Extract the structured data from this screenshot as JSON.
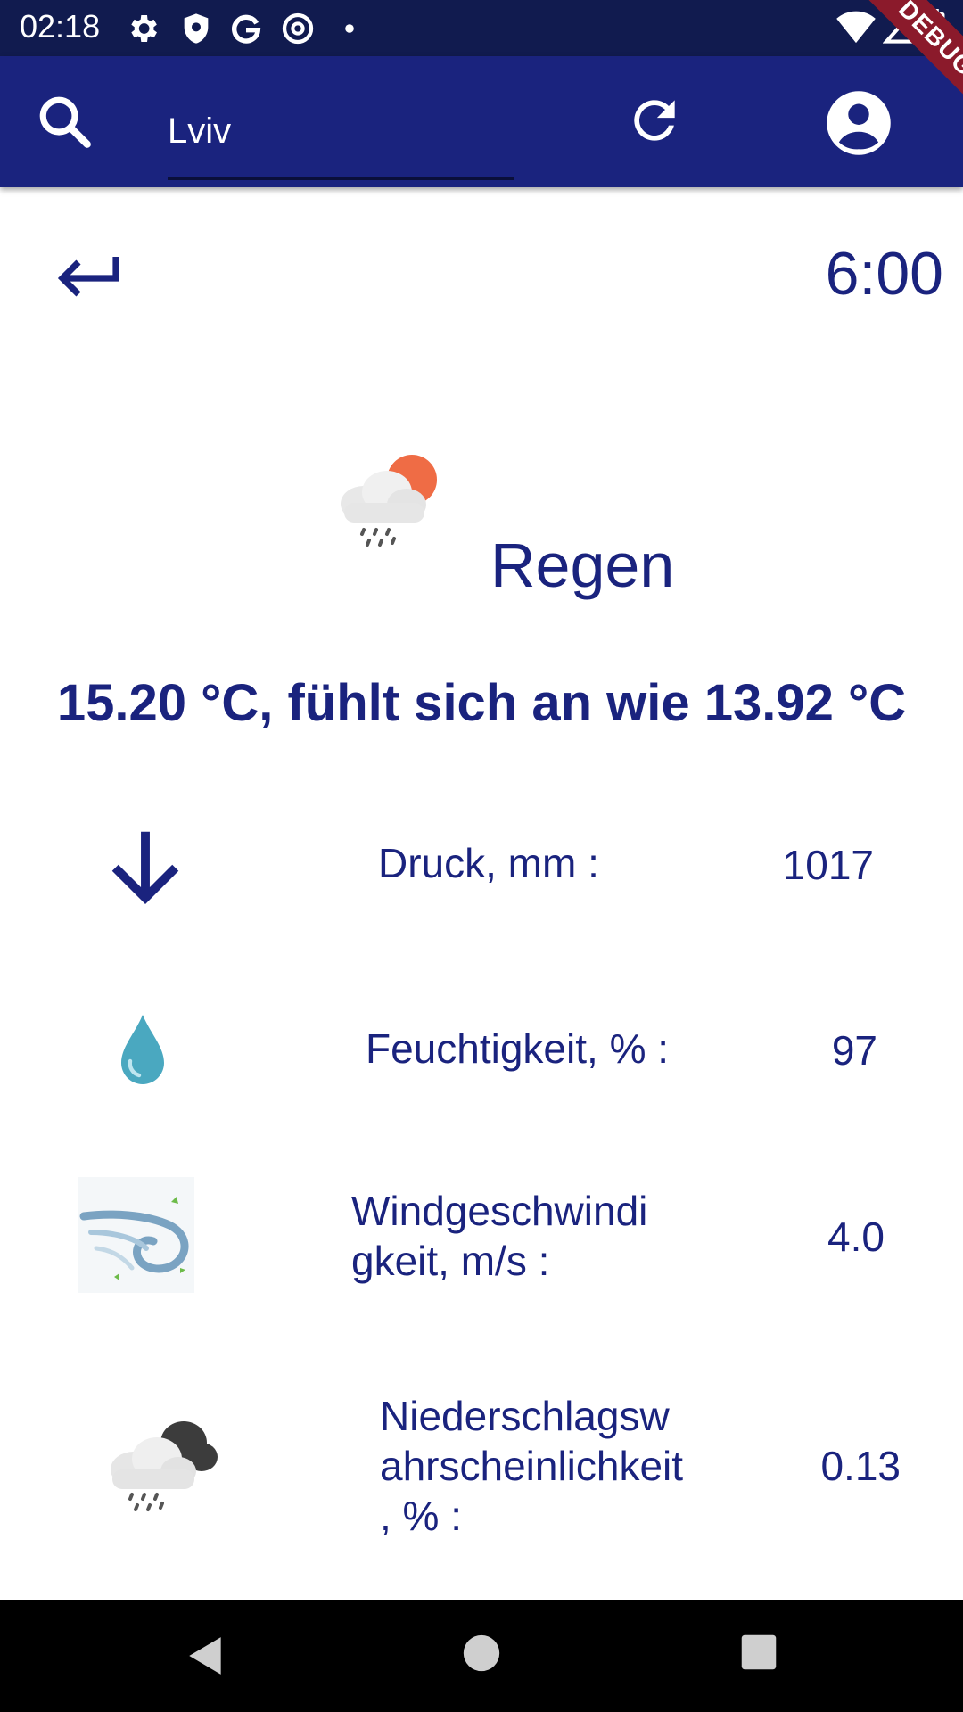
{
  "status_bar": {
    "time": "02:18"
  },
  "app_bar": {
    "search_value": "Lviv",
    "debug_label": "DEBUG"
  },
  "detail": {
    "time": "6:00",
    "condition": "Regen",
    "temperature_line": "15.20 °C, fühlt sich an wie 13.92 °C"
  },
  "rows": [
    {
      "icon": "arrow-down-icon",
      "label": "Druck, mm :",
      "value": "1017"
    },
    {
      "icon": "water-drop-icon",
      "label": "Feuchtigkeit, % :",
      "value": "97"
    },
    {
      "icon": "wind-icon",
      "label_lines": [
        "Windgeschwindi",
        "gkeit, m/s :"
      ],
      "value": "4.0"
    },
    {
      "icon": "rain-cloud-icon",
      "label_lines": [
        "Niederschlagsw",
        "ahrscheinlichkeit",
        ", % :"
      ],
      "value": "0.13"
    }
  ],
  "colors": {
    "primary": "#1a237e",
    "status_bar": "#111b4f",
    "debug": "#8b1a2b"
  }
}
